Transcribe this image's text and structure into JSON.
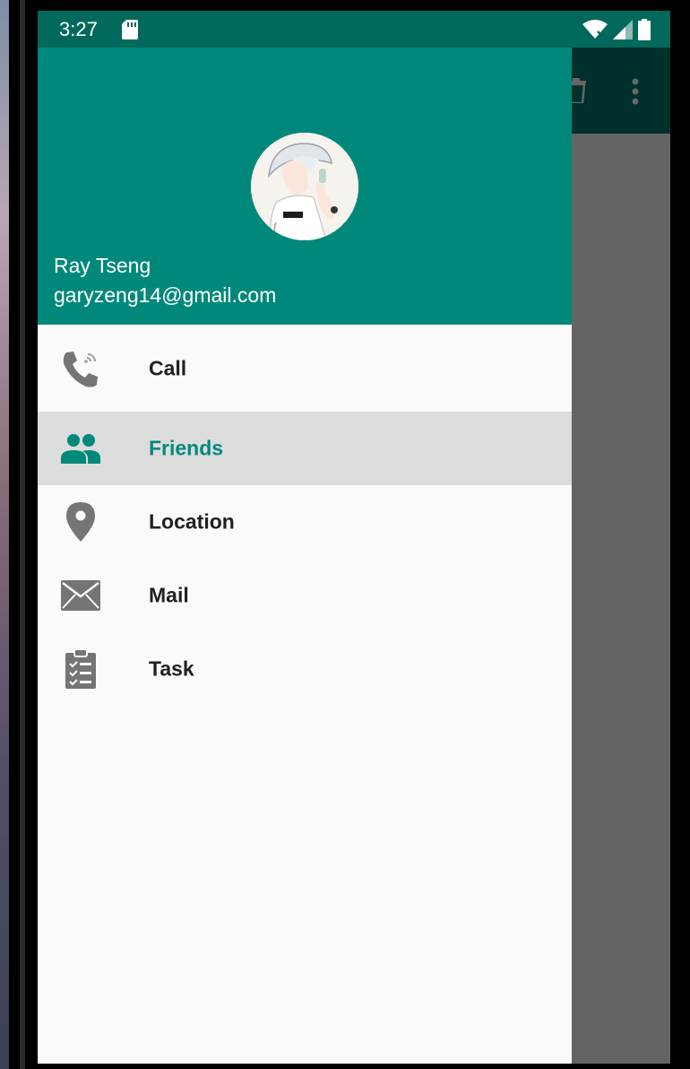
{
  "status_bar": {
    "time": "3:27",
    "icons": [
      "sd-card-icon",
      "wifi-icon",
      "cell-signal-icon",
      "battery-icon"
    ]
  },
  "app_toolbar": {
    "actions": [
      "delete-icon",
      "more-vert-icon"
    ]
  },
  "drawer": {
    "header": {
      "user_name": "Ray Tseng",
      "user_email": "garyzeng14@gmail.com"
    },
    "menu": [
      {
        "label": "Call",
        "icon": "phone-icon",
        "selected": false
      },
      {
        "label": "Friends",
        "icon": "people-icon",
        "selected": true
      },
      {
        "label": "Location",
        "icon": "location-pin-icon",
        "selected": false
      },
      {
        "label": "Mail",
        "icon": "mail-icon",
        "selected": false
      },
      {
        "label": "Task",
        "icon": "clipboard-icon",
        "selected": false
      }
    ]
  },
  "colors": {
    "primary": "#00897b",
    "primary_dark": "#00695c",
    "selected_bg": "#dcdcdc",
    "icon_gray": "#757575"
  }
}
